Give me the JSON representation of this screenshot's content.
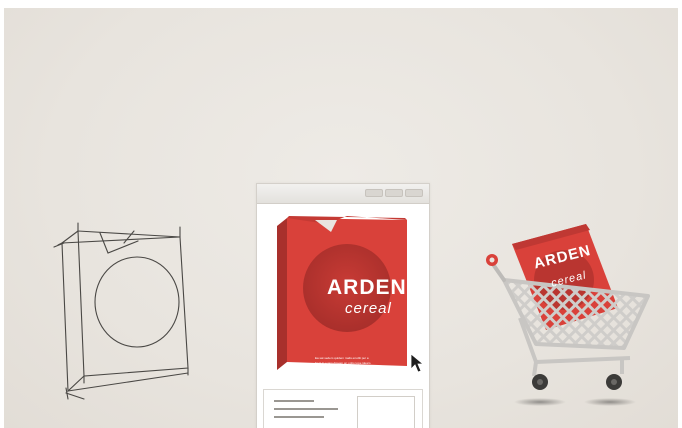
{
  "product": {
    "brand": "ARDEN",
    "subtitle": "cereal",
    "fine_print_line1": "Ea sat sedem quidem malis eruditi per a",
    "fine_print_line2": "Eruit in euam diceam an optio tope ideam."
  },
  "cart_product": {
    "brand": "ARDEN",
    "subtitle": "cereal"
  },
  "icons": {
    "sketch": "box-sketch-icon",
    "window": "browser-window-icon",
    "cursor": "mouse-cursor-icon",
    "cart": "shopping-cart-icon"
  },
  "colors": {
    "brand_red": "#d9413a",
    "dark_red": "#b93530",
    "cart_grey": "#c8c6c3",
    "background": "#e9e5df"
  }
}
